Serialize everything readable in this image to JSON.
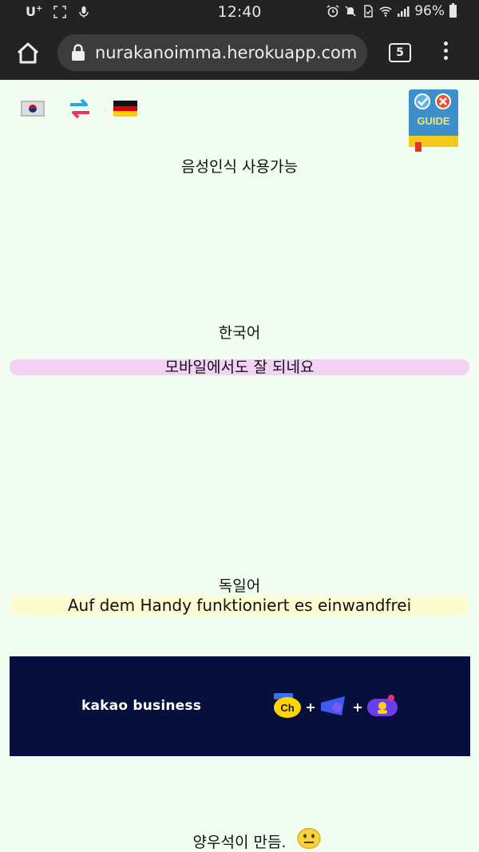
{
  "status_bar": {
    "carrier": "U",
    "carrier_plus": "+",
    "time": "12:40",
    "battery": "96%"
  },
  "browser": {
    "url": "nurakanoimma.herokuapp.com",
    "tab_count": "5"
  },
  "page": {
    "speech_label": "음성인식 사용가능",
    "source_lang": "한국어",
    "source_text": "모바일에서도 잘 되네요",
    "target_lang": "독일어",
    "target_text": "Auf dem Handy funktioniert es einwandfrei",
    "guide_label": "GUIDE",
    "credit": "양우석이 만듬."
  },
  "ad": {
    "brand": "kakao business",
    "ch_label": "Ch"
  },
  "colors": {
    "source_pill": "#f3d2f6",
    "target_pill": "#fbfcd2",
    "page_bg": "#f1fdf1",
    "ad_bg": "#07103d"
  }
}
